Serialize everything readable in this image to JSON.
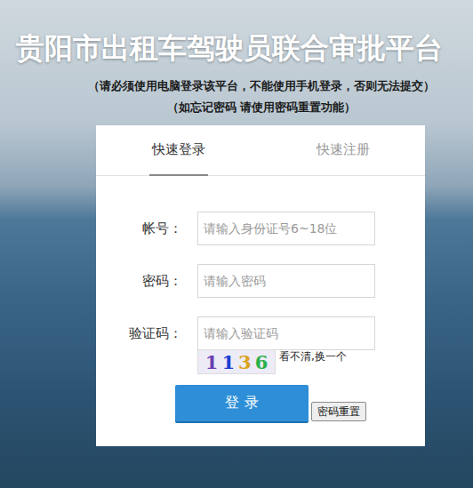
{
  "page": {
    "title": "贵阳市出租车驾驶员联合审批平台",
    "notes": [
      "（请必须使用电脑登录该平台，不能使用手机登录，否则无法提交）",
      "（如忘记密码 请使用密码重置功能）"
    ]
  },
  "tabs": [
    {
      "label": "快速登录",
      "selected": true
    },
    {
      "label": "快速注册",
      "selected": false
    }
  ],
  "fields": [
    {
      "label": "帐号：",
      "placeholder": "请输入身份证号6~18位",
      "kind": "text"
    },
    {
      "label": "密码：",
      "placeholder": "请输入密码",
      "kind": "password"
    },
    {
      "label": "验证码：",
      "placeholder": "请输入验证码",
      "kind": "captcha"
    }
  ],
  "captcha": {
    "chars": [
      {
        "text": "1",
        "color": "#6a3fb0"
      },
      {
        "text": "1",
        "color": "#1a3fd0"
      },
      {
        "text": "3",
        "color": "#d9a21c"
      },
      {
        "text": "6",
        "color": "#2bb04a"
      }
    ],
    "refresh": "看不清,换一个"
  },
  "buttons": {
    "login": "登 录",
    "reset": "密码重置"
  }
}
